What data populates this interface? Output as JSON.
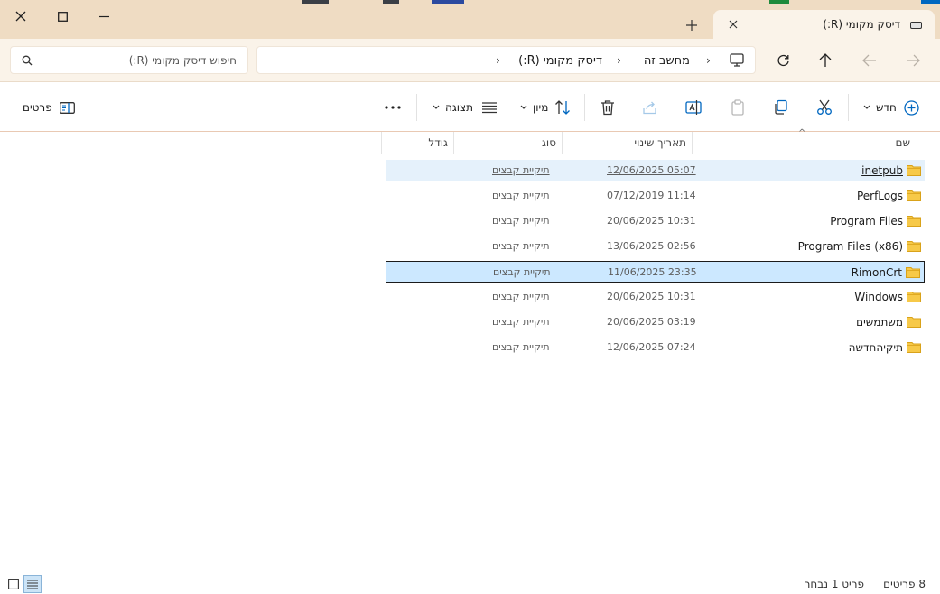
{
  "window": {
    "tab_title": "דיסק מקומי (R:)",
    "accent": "#0067c0"
  },
  "address": {
    "crumbs": [
      "מחשב זה",
      "דיסק מקומי (R:)"
    ],
    "search_placeholder": "חיפוש דיסק מקומי (R:)"
  },
  "toolbar": {
    "new_label": "חדש",
    "sort_label": "מיון",
    "view_label": "תצוגה",
    "details_label": "פרטים",
    "more_label": "..."
  },
  "columns": {
    "name": "שם",
    "date": "תאריך שינוי",
    "type": "סוג",
    "size": "גודל"
  },
  "files": [
    {
      "name": "inetpub",
      "date": "12/06/2025 05:07",
      "type": "תיקיית קבצים"
    },
    {
      "name": "PerfLogs",
      "date": "07/12/2019 11:14",
      "type": "תיקיית קבצים"
    },
    {
      "name": "Program Files",
      "date": "20/06/2025 10:31",
      "type": "תיקיית קבצים"
    },
    {
      "name": "Program Files (x86)",
      "date": "13/06/2025 02:56",
      "type": "תיקיית קבצים"
    },
    {
      "name": "RimonCrt",
      "date": "11/06/2025 23:35",
      "type": "תיקיית קבצים"
    },
    {
      "name": "Windows",
      "date": "20/06/2025 10:31",
      "type": "תיקיית קבצים"
    },
    {
      "name": "משתמשים",
      "date": "20/06/2025 03:19",
      "type": "תיקיית קבצים"
    },
    {
      "name": "תיקיהחדשה",
      "date": "12/06/2025 07:24",
      "type": "תיקיית קבצים"
    }
  ],
  "status": {
    "count": "8 פריטים",
    "selected": "פריט 1 נבחר"
  }
}
